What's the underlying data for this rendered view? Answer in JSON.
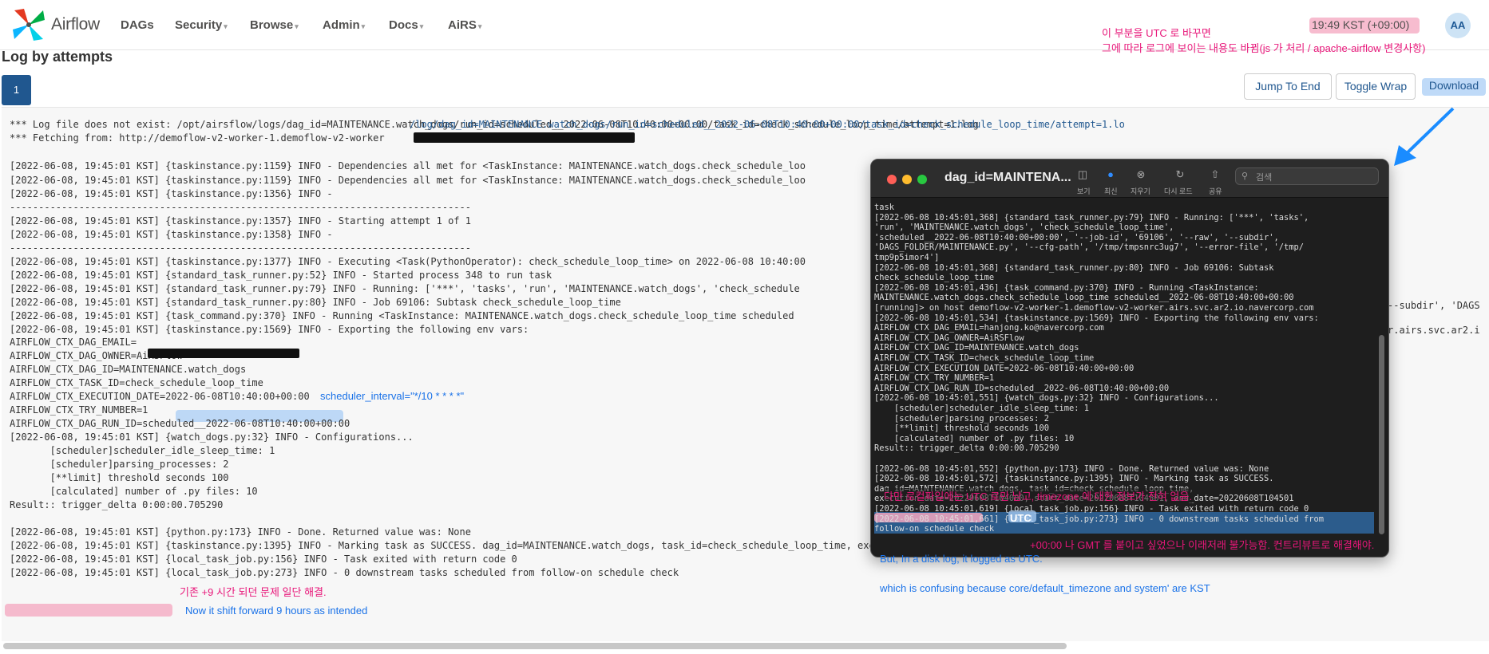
{
  "nav": {
    "brand": "Airflow",
    "items": [
      "DAGs",
      "Security",
      "Browse",
      "Admin",
      "Docs",
      "AiRS"
    ],
    "clock": "19:49 KST (+09:00)",
    "user_initials": "AA"
  },
  "page": {
    "title": "Log by attempts",
    "attempt": "1",
    "buttons": {
      "jump": "Jump To End",
      "wrap": "Toggle Wrap",
      "download": "Download"
    }
  },
  "log": {
    "lines": [
      "*** Log file does not exist: /opt/airsflow/logs/dag_id=MAINTENANCE.watch_dogs/run_id=scheduled__2022-06-08T10:40:00+00:00/task_id=check_schedule_loop_time/attempt=1.log",
      "*** Fetching from: http://demoflow-v2-worker-1.demoflow-v2-worker",
      "",
      "[2022-06-08, 19:45:01 KST] {taskinstance.py:1159} INFO - Dependencies all met for <TaskInstance: MAINTENANCE.watch_dogs.check_schedule_loo",
      "[2022-06-08, 19:45:01 KST] {taskinstance.py:1159} INFO - Dependencies all met for <TaskInstance: MAINTENANCE.watch_dogs.check_schedule_loo",
      "[2022-06-08, 19:45:01 KST] {taskinstance.py:1356} INFO -",
      "--------------------------------------------------------------------------------",
      "[2022-06-08, 19:45:01 KST] {taskinstance.py:1357} INFO - Starting attempt 1 of 1",
      "[2022-06-08, 19:45:01 KST] {taskinstance.py:1358} INFO -",
      "--------------------------------------------------------------------------------",
      "[2022-06-08, 19:45:01 KST] {taskinstance.py:1377} INFO - Executing <Task(PythonOperator): check_schedule_loop_time> on 2022-06-08 10:40:00",
      "[2022-06-08, 19:45:01 KST] {standard_task_runner.py:52} INFO - Started process 348 to run task",
      "[2022-06-08, 19:45:01 KST] {standard_task_runner.py:79} INFO - Running: ['***', 'tasks', 'run', 'MAINTENANCE.watch_dogs', 'check_schedule",
      "[2022-06-08, 19:45:01 KST] {standard_task_runner.py:80} INFO - Job 69106: Subtask check_schedule_loop_time",
      "[2022-06-08, 19:45:01 KST] {task_command.py:370} INFO - Running <TaskInstance: MAINTENANCE.watch_dogs.check_schedule_loop_time scheduled",
      "[2022-06-08, 19:45:01 KST] {taskinstance.py:1569} INFO - Exporting the following env vars:",
      "AIRFLOW_CTX_DAG_EMAIL=",
      "AIRFLOW_CTX_DAG_OWNER=AiRSFlow",
      "AIRFLOW_CTX_DAG_ID=MAINTENANCE.watch_dogs",
      "AIRFLOW_CTX_TASK_ID=check_schedule_loop_time",
      "AIRFLOW_CTX_EXECUTION_DATE=2022-06-08T10:40:00+00:00",
      "AIRFLOW_CTX_TRY_NUMBER=1",
      "AIRFLOW_CTX_DAG_RUN_ID=scheduled__2022-06-08T10:40:00+00:00",
      "[2022-06-08, 19:45:01 KST] {watch_dogs.py:32} INFO - Configurations...",
      "       [scheduler]scheduler_idle_sleep_time: 1",
      "       [scheduler]parsing_processes: 2",
      "       [**limit] threshold seconds 100",
      "       [calculated] number of .py files: 10",
      "Result:: trigger_delta 0:00:00.705290",
      "",
      "[2022-06-08, 19:45:01 KST] {python.py:173} INFO - Done. Returned value was: None",
      "[2022-06-08, 19:45:01 KST] {taskinstance.py:1395} INFO - Marking task as SUCCESS. dag_id=MAINTENANCE.watch_dogs, task_id=check_schedule_loop_time, execution_date=20220608T104000, start_date=20220608T104501, end_date=20220608T104501",
      "[2022-06-08, 19:45:01 KST] {local_task_job.py:156} INFO - Task exited with return code 0",
      "[2022-06-08, 19:45:01 KST] {local_task_job.py:273} INFO - 0 downstream tasks scheduled from follow-on schedule check"
    ],
    "fetch_tail": "/log/dag_id=MAINTENANCE.watch_dogs/run_id=scheduled__2022-06-08T10:40:00+00:00/task_id=check_schedule_loop_time/attempt=1.lo",
    "right_fragment_1": "--subdir', 'DAGS",
    "right_fragment_2": "r.airs.svc.ar2.i"
  },
  "mac": {
    "title": "dag_id=MAINTENA...",
    "toolbar": [
      "보기",
      "최신",
      "지우기",
      "다시 로드",
      "공유"
    ],
    "search_placeholder": "검색",
    "lines": [
      "task",
      "[2022-06-08 10:45:01,368] {standard_task_runner.py:79} INFO - Running: ['***', 'tasks',",
      "'run', 'MAINTENANCE.watch_dogs', 'check_schedule_loop_time',",
      "'scheduled__2022-06-08T10:40:00+00:00', '--job-id', '69106', '--raw', '--subdir',",
      "'DAGS_FOLDER/MAINTENANCE.py', '--cfg-path', '/tmp/tmpsnrc3ug7', '--error-file', '/tmp/",
      "tmp9p5imor4']",
      "[2022-06-08 10:45:01,368] {standard_task_runner.py:80} INFO - Job 69106: Subtask",
      "check_schedule_loop_time",
      "[2022-06-08 10:45:01,436] {task_command.py:370} INFO - Running <TaskInstance:",
      "MAINTENANCE.watch_dogs.check_schedule_loop_time scheduled__2022-06-08T10:40:00+00:00",
      "[running]> on host demoflow-v2-worker-1.demoflow-v2-worker.airs.svc.ar2.io.navercorp.com",
      "[2022-06-08 10:45:01,534] {taskinstance.py:1569} INFO - Exporting the following env vars:",
      "AIRFLOW_CTX_DAG_EMAIL=hanjong.ko@navercorp.com",
      "AIRFLOW_CTX_DAG_OWNER=AiRSFlow",
      "AIRFLOW_CTX_DAG_ID=MAINTENANCE.watch_dogs",
      "AIRFLOW_CTX_TASK_ID=check_schedule_loop_time",
      "AIRFLOW_CTX_EXECUTION_DATE=2022-06-08T10:40:00+00:00",
      "AIRFLOW_CTX_TRY_NUMBER=1",
      "AIRFLOW_CTX_DAG_RUN_ID=scheduled__2022-06-08T10:40:00+00:00",
      "[2022-06-08 10:45:01,551] {watch_dogs.py:32} INFO - Configurations...",
      "    [scheduler]scheduler_idle_sleep_time: 1",
      "    [scheduler]parsing_processes: 2",
      "    [**limit] threshold seconds 100",
      "    [calculated] number of .py files: 10",
      "Result:: trigger_delta 0:00:00.705290",
      "",
      "[2022-06-08 10:45:01,552] {python.py:173} INFO - Done. Returned value was: None",
      "[2022-06-08 10:45:01,572] {taskinstance.py:1395} INFO - Marking task as SUCCESS.",
      "dag_id=MAINTENANCE.watch_dogs, task_id=check_schedule_loop_time,",
      "execution_date=20220608T104000, start_date=20220608T104501, end_date=20220608T104501",
      "[2022-06-08 10:45:01,619] {local_task_job.py:156} INFO - Task exited with return code 0",
      "[2022-06-08 10:45:01,661] {local_task_job.py:273} INFO - 0 downstream tasks scheduled from",
      "follow-on schedule check"
    ]
  },
  "annotations": {
    "top_right_1": "이 부분을 UTC 로 바꾸면",
    "top_right_2": "그에 따라 로그에 보이는 내용도 바뀜(js 가 처리 / apache-airflow 변경사항)",
    "scheduler_interval": "scheduler_interval=\"*/10 * * * *\"",
    "utc_note": "다만 로컬파일에는 UTC 로만 남고, timezone 에 대한 정보가 전혀 없음.",
    "utc_label": "UTC",
    "gmt_note": "+00:00 나 GMT 를 붙이고 싶었으나 이래저래 불가능함. 컨트리뷰트로 해결해야.",
    "disk_log_1": "But, In a disk log, it logged as UTC.",
    "disk_log_2": "which is confusing because core/default_timezone and system' are KST",
    "shift_ko": "기존 +9 시간 되던 문제 일단 해결.",
    "shift_en": "Now it shift forward 9 hours as intended"
  },
  "colors": {
    "brand_blue": "#20578f",
    "note_pink": "#e8177a",
    "note_blue": "#1a72e8"
  }
}
